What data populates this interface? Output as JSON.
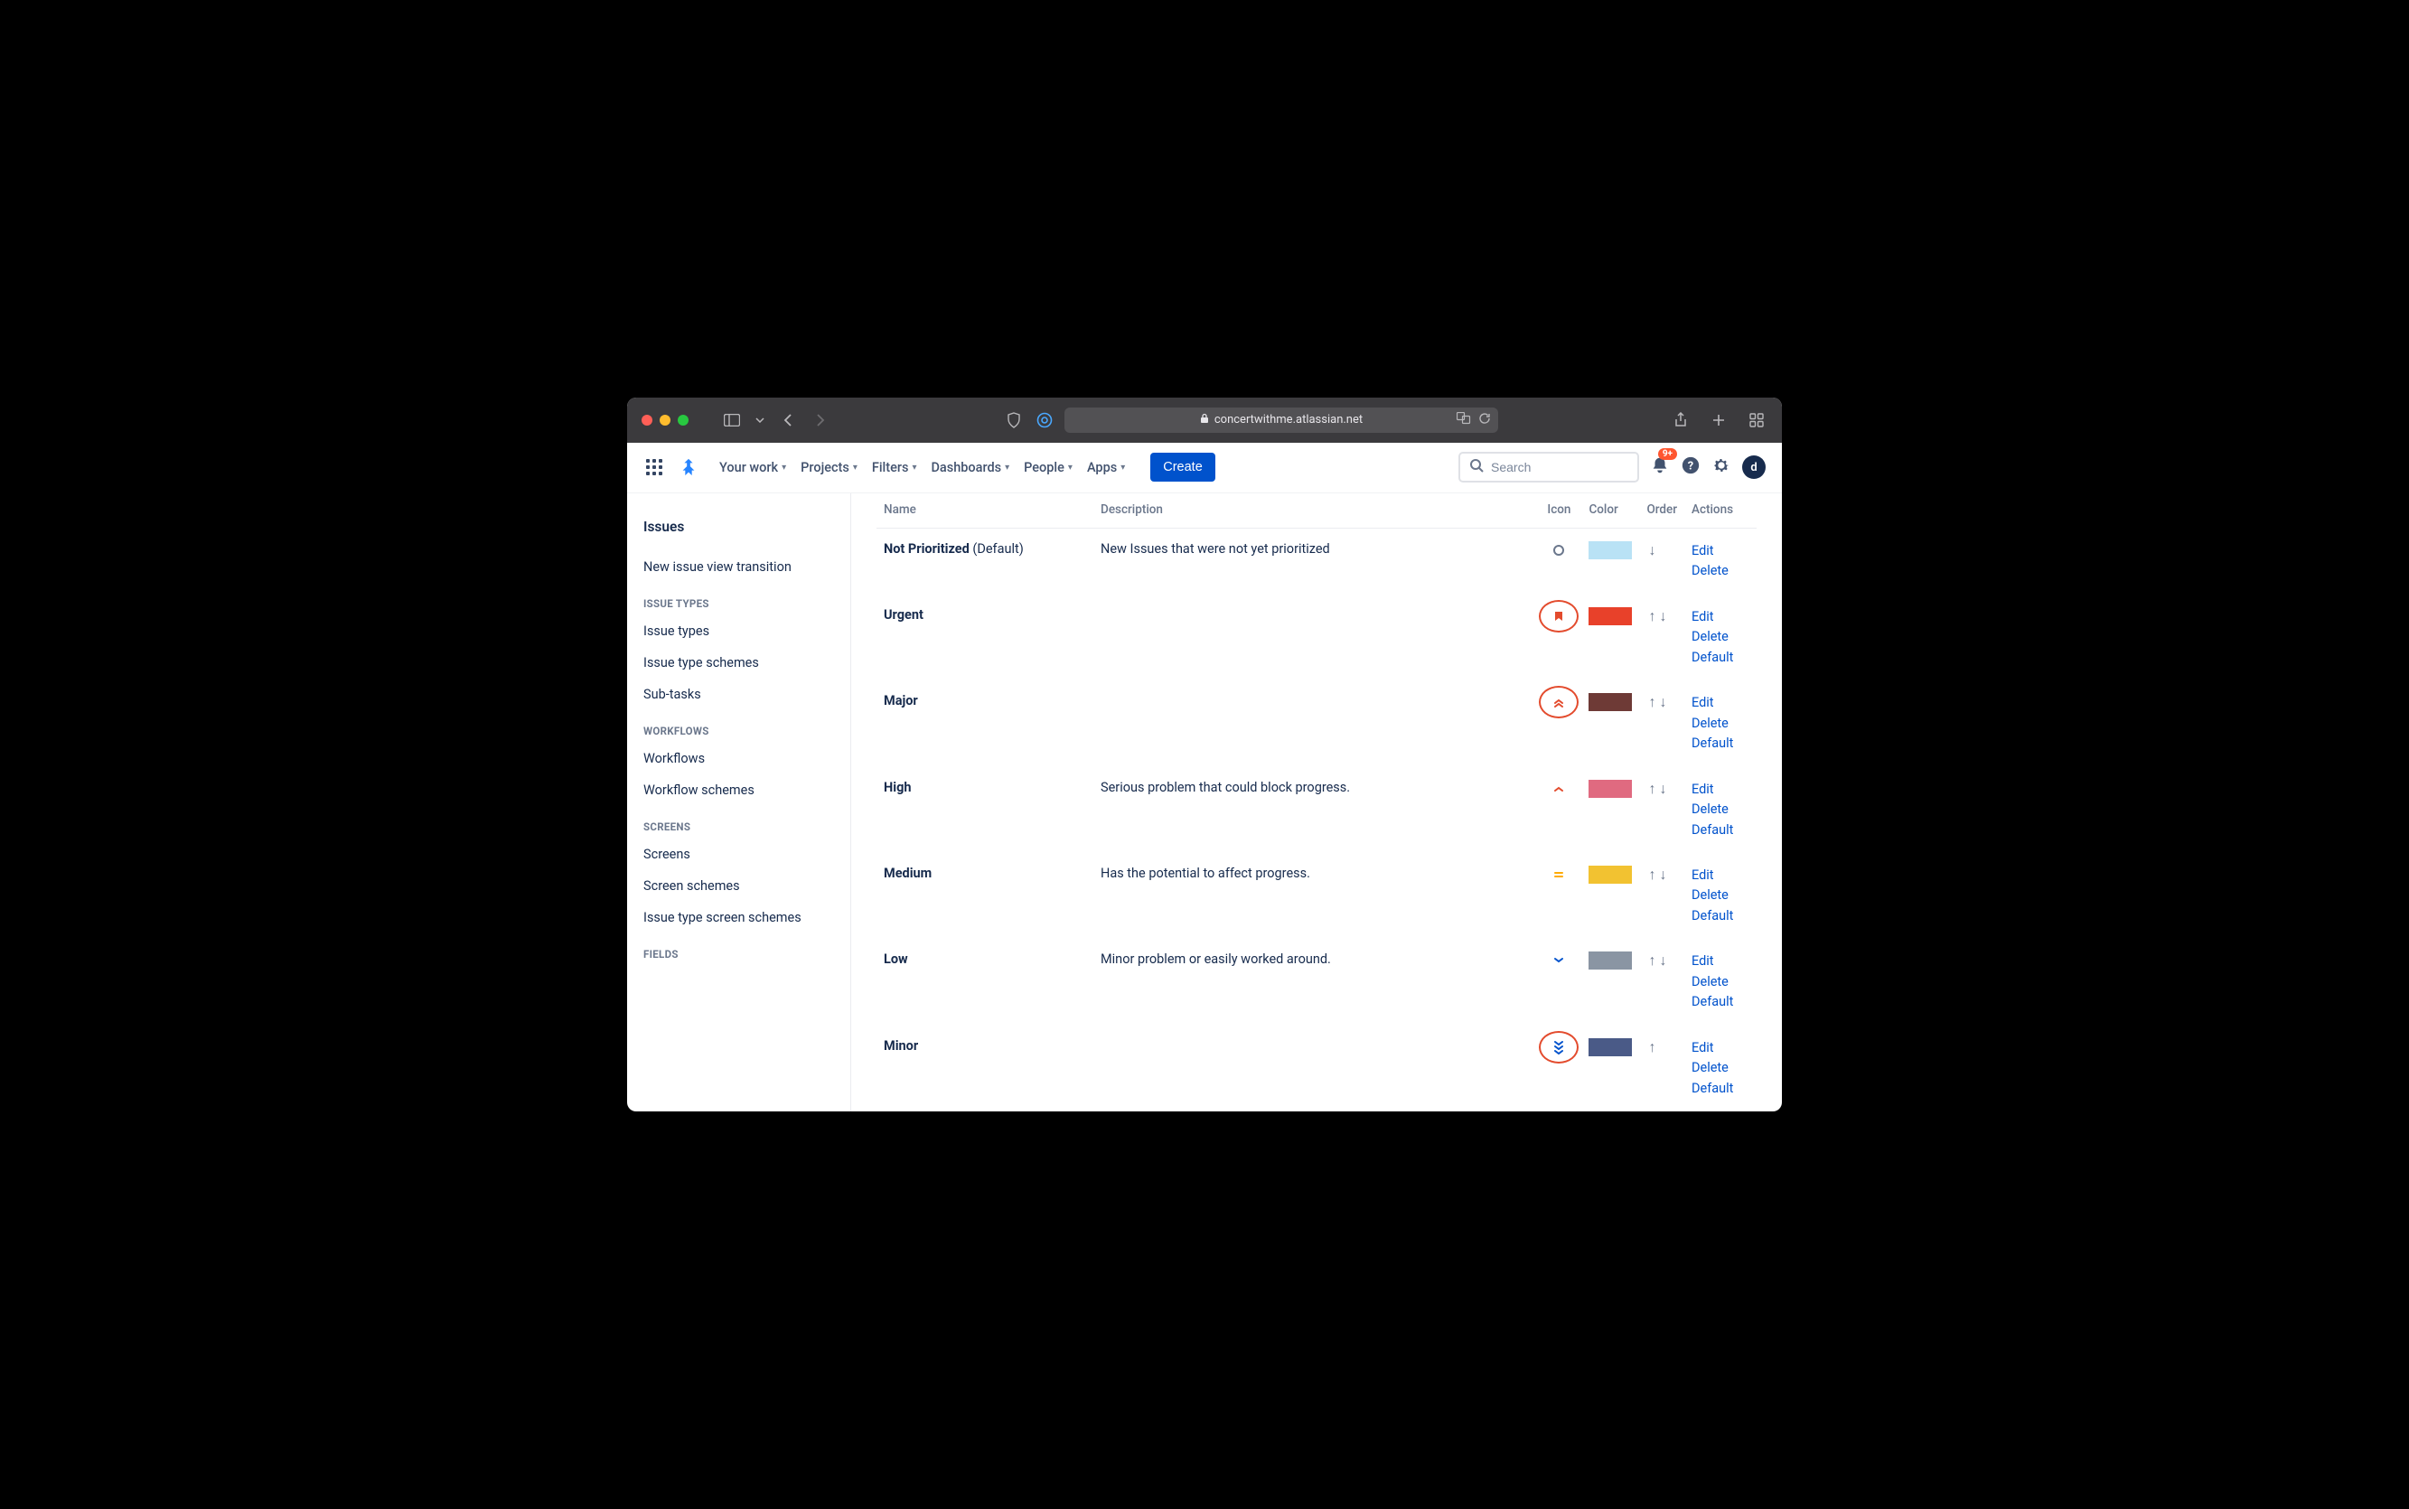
{
  "browser": {
    "url_host": "concertwithme.atlassian.net"
  },
  "topnav": {
    "items": [
      "Your work",
      "Projects",
      "Filters",
      "Dashboards",
      "People",
      "Apps"
    ],
    "create": "Create",
    "search_placeholder": "Search",
    "notif_badge": "9+",
    "avatar_initial": "d"
  },
  "sidebar": {
    "title": "Issues",
    "top_links": [
      "New issue view transition"
    ],
    "sections": [
      {
        "heading": "ISSUE TYPES",
        "links": [
          "Issue types",
          "Issue type schemes",
          "Sub-tasks"
        ]
      },
      {
        "heading": "WORKFLOWS",
        "links": [
          "Workflows",
          "Workflow schemes"
        ]
      },
      {
        "heading": "SCREENS",
        "links": [
          "Screens",
          "Screen schemes",
          "Issue type screen schemes"
        ]
      },
      {
        "heading": "FIELDS",
        "links": []
      }
    ]
  },
  "table": {
    "headers": {
      "name": "Name",
      "description": "Description",
      "icon": "Icon",
      "color": "Color",
      "order": "Order",
      "actions": "Actions"
    },
    "action_labels": {
      "edit": "Edit",
      "delete": "Delete",
      "default": "Default"
    },
    "default_suffix": "(Default)",
    "rows": [
      {
        "name": "Not Prioritized",
        "is_default": true,
        "description": "New Issues that were not yet prioritized",
        "icon": "circle-open",
        "icon_color": "#6b778c",
        "color": "#b9e2f5",
        "up": false,
        "down": true,
        "circled": false,
        "actions": [
          "edit",
          "delete"
        ]
      },
      {
        "name": "Urgent",
        "is_default": false,
        "description": "",
        "icon": "bookmark",
        "icon_color": "#e34b2d",
        "color": "#e8412a",
        "up": true,
        "down": true,
        "circled": true,
        "actions": [
          "edit",
          "delete",
          "default"
        ]
      },
      {
        "name": "Major",
        "is_default": false,
        "description": "",
        "icon": "double-up",
        "icon_color": "#e34b2d",
        "color": "#6e3a36",
        "up": true,
        "down": true,
        "circled": true,
        "actions": [
          "edit",
          "delete",
          "default"
        ]
      },
      {
        "name": "High",
        "is_default": false,
        "description": "Serious problem that could block progress.",
        "icon": "chev-up",
        "icon_color": "#e34b2d",
        "color": "#e06a80",
        "up": true,
        "down": true,
        "circled": false,
        "actions": [
          "edit",
          "delete",
          "default"
        ]
      },
      {
        "name": "Medium",
        "is_default": false,
        "description": "Has the potential to affect progress.",
        "icon": "equals",
        "icon_color": "#ffab00",
        "color": "#f2c231",
        "up": true,
        "down": true,
        "circled": false,
        "actions": [
          "edit",
          "delete",
          "default"
        ]
      },
      {
        "name": "Low",
        "is_default": false,
        "description": "Minor problem or easily worked around.",
        "icon": "chev-down",
        "icon_color": "#0052cc",
        "color": "#8a95a3",
        "up": true,
        "down": true,
        "circled": false,
        "actions": [
          "edit",
          "delete",
          "default"
        ]
      },
      {
        "name": "Minor",
        "is_default": false,
        "description": "",
        "icon": "triple-down",
        "icon_color": "#0052cc",
        "color": "#4a5a87",
        "up": true,
        "down": false,
        "circled": true,
        "actions": [
          "edit",
          "delete",
          "default"
        ]
      }
    ]
  }
}
